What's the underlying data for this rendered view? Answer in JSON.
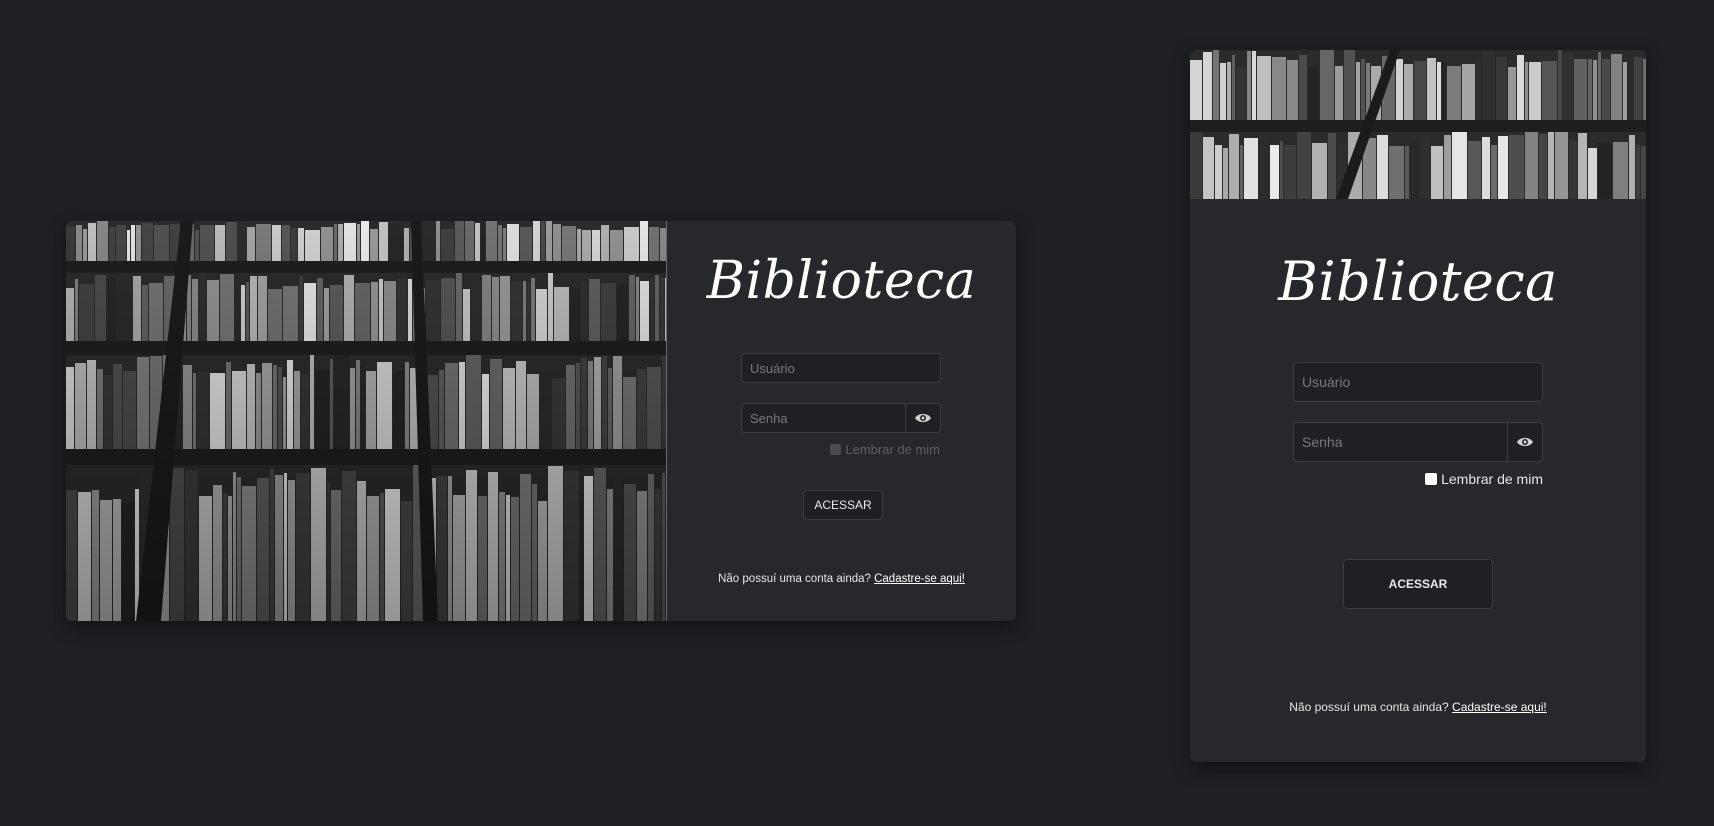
{
  "desktop": {
    "brand": "Biblioteca",
    "username_placeholder": "Usuário",
    "password_placeholder": "Senha",
    "remember_label": "Lembrar de mim",
    "submit_label": "ACESSAR",
    "signup_prompt": "Não possuí uma conta ainda?",
    "signup_link": "Cadastre-se aqui!"
  },
  "mobile": {
    "brand": "Biblioteca",
    "username_placeholder": "Usuário",
    "password_placeholder": "Senha",
    "remember_label": "Lembrar de mim",
    "submit_label": "ACESSAR",
    "signup_prompt": "Não possuí uma conta ainda?",
    "signup_link": "Cadastre-se aqui!"
  },
  "icons": {
    "eye": "eye-icon"
  },
  "colors": {
    "page_bg": "#1f2024",
    "card_bg": "#27282c",
    "input_bg": "#1f2023",
    "border": "#3c3d42",
    "text": "#e6e6e6"
  }
}
